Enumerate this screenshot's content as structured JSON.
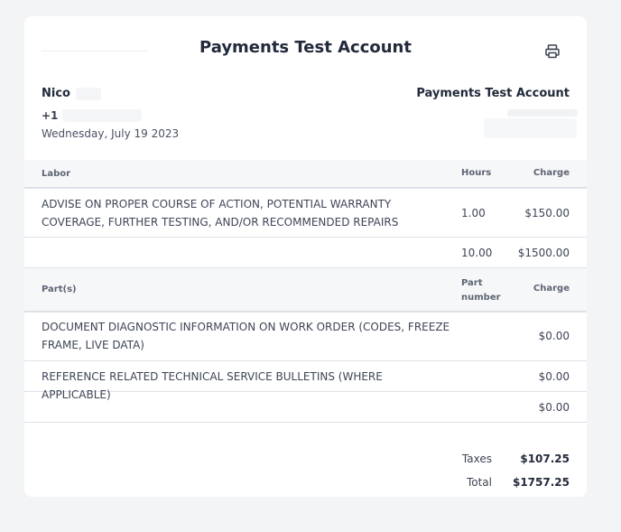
{
  "header": {
    "title": "Payments Test Account"
  },
  "customer": {
    "name": "Nico",
    "phone": "+1 (",
    "date": "Wednesday, July 19 2023"
  },
  "shop": {
    "name": "Payments Test Account"
  },
  "labor": {
    "headers": {
      "description": "Labor",
      "hours": "Hours",
      "charge": "Charge"
    },
    "rows": [
      {
        "description": "ADVISE ON PROPER COURSE OF ACTION, POTENTIAL WARRANTY COVERAGE, FURTHER TESTING, AND/OR RECOMMENDED REPAIRS",
        "hours": "1.00",
        "charge": "$150.00"
      }
    ],
    "subtotal": {
      "hours": "10.00",
      "charge": "$1500.00"
    }
  },
  "parts": {
    "headers": {
      "description": "Part(s)",
      "part_number": "Part number",
      "charge": "Charge"
    },
    "rows": [
      {
        "description": "DOCUMENT DIAGNOSTIC INFORMATION ON WORK ORDER (CODES, FREEZE FRAME, LIVE DATA)",
        "charge": "$0.00"
      },
      {
        "description": "REFERENCE RELATED TECHNICAL SERVICE BULLETINS (WHERE APPLICABLE)",
        "charge": "$0.00"
      }
    ],
    "subtotal": {
      "charge": "$0.00"
    }
  },
  "totals": {
    "taxes_label": "Taxes",
    "taxes_value": "$107.25",
    "total_label": "Total",
    "total_value": "$1757.25"
  },
  "icons": {
    "print": "printer-icon"
  }
}
